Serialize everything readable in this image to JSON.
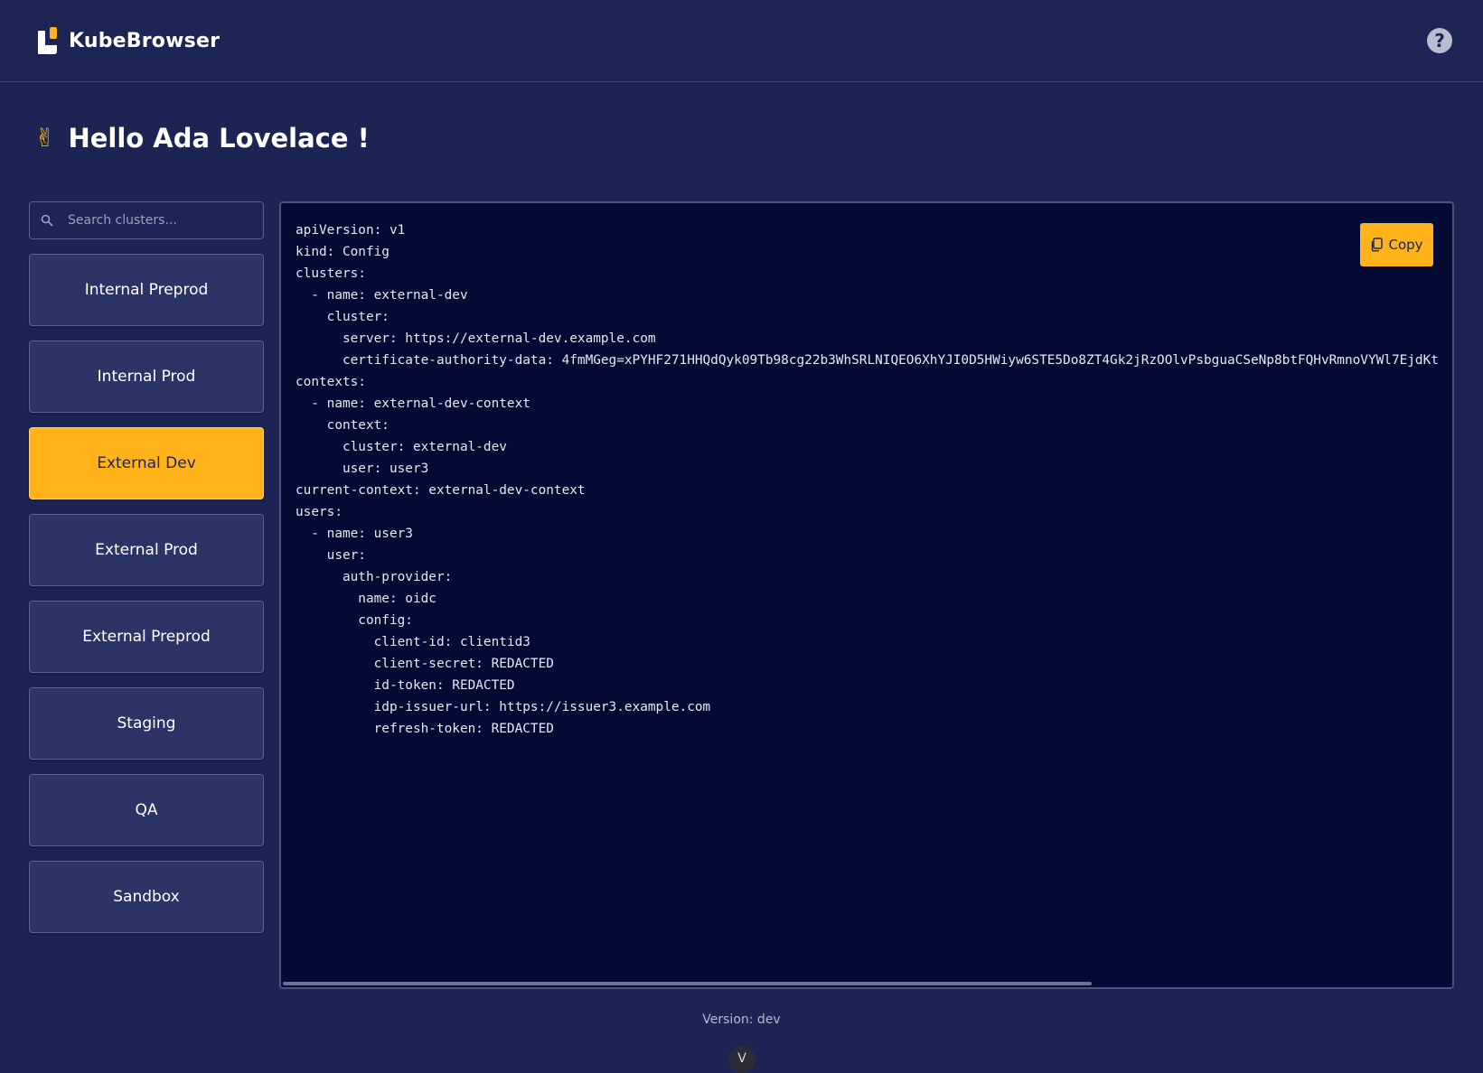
{
  "app": {
    "name": "KubeBrowser",
    "help_label": "?"
  },
  "greeting": {
    "emoji": "✌",
    "text": "Hello Ada Lovelace !"
  },
  "search": {
    "placeholder": "Search clusters..."
  },
  "clusters": [
    {
      "label": "Internal Preprod",
      "active": false
    },
    {
      "label": "Internal Prod",
      "active": false
    },
    {
      "label": "External Dev",
      "active": true
    },
    {
      "label": "External Prod",
      "active": false
    },
    {
      "label": "External Preprod",
      "active": false
    },
    {
      "label": "Staging",
      "active": false
    },
    {
      "label": "QA",
      "active": false
    },
    {
      "label": "Sandbox",
      "active": false
    }
  ],
  "config": {
    "copy_label": "Copy",
    "yaml": "apiVersion: v1\nkind: Config\nclusters:\n  - name: external-dev\n    cluster:\n      server: https://external-dev.example.com\n      certificate-authority-data: 4fmMGeg=xPYHF271HHQdQyk09Tb98cg22b3WhSRLNIQEO6XhYJI0D5HWiyw6STE5Do8ZT4Gk2jRzOOlvPsbguaCSeNp8btFQHvRmnoVYWl7EjdKt\ncontexts:\n  - name: external-dev-context\n    context:\n      cluster: external-dev\n      user: user3\ncurrent-context: external-dev-context\nusers:\n  - name: user3\n    user:\n      auth-provider:\n        name: oidc\n        config:\n          client-id: clientid3\n          client-secret: REDACTED\n          id-token: REDACTED\n          idp-issuer-url: https://issuer3.example.com\n          refresh-token: REDACTED"
  },
  "footer": {
    "version": "Version: dev",
    "chevron": "V"
  },
  "colors": {
    "background": "#1b2452",
    "accent": "#ffb21a",
    "code_background": "#030a33"
  }
}
